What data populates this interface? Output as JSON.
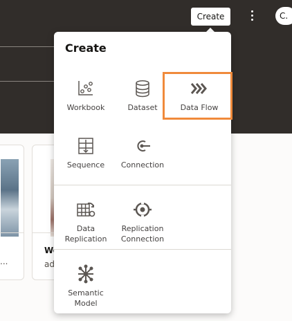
{
  "header": {
    "create_label": "Create",
    "avatar_text": "C."
  },
  "background_cards": {
    "card1_text": "...",
    "card2_title": "Wo",
    "card2_subtitle": "ad"
  },
  "menu": {
    "title": "Create",
    "items": [
      {
        "label": "Workbook",
        "icon": "workbook-icon"
      },
      {
        "label": "Dataset",
        "icon": "dataset-icon"
      },
      {
        "label": "Data Flow",
        "icon": "data-flow-icon"
      },
      {
        "label": "Sequence",
        "icon": "sequence-icon"
      },
      {
        "label": "Connection",
        "icon": "connection-icon"
      },
      {
        "label": "Data Replication",
        "icon": "data-replication-icon"
      },
      {
        "label": "Replication Connection",
        "icon": "replication-connection-icon"
      },
      {
        "label": "Semantic Model",
        "icon": "semantic-model-icon"
      }
    ]
  },
  "colors": {
    "topbar": "#312d2a",
    "highlight": "#f08a3b",
    "icon": "#5b5652",
    "text": "#444140"
  }
}
